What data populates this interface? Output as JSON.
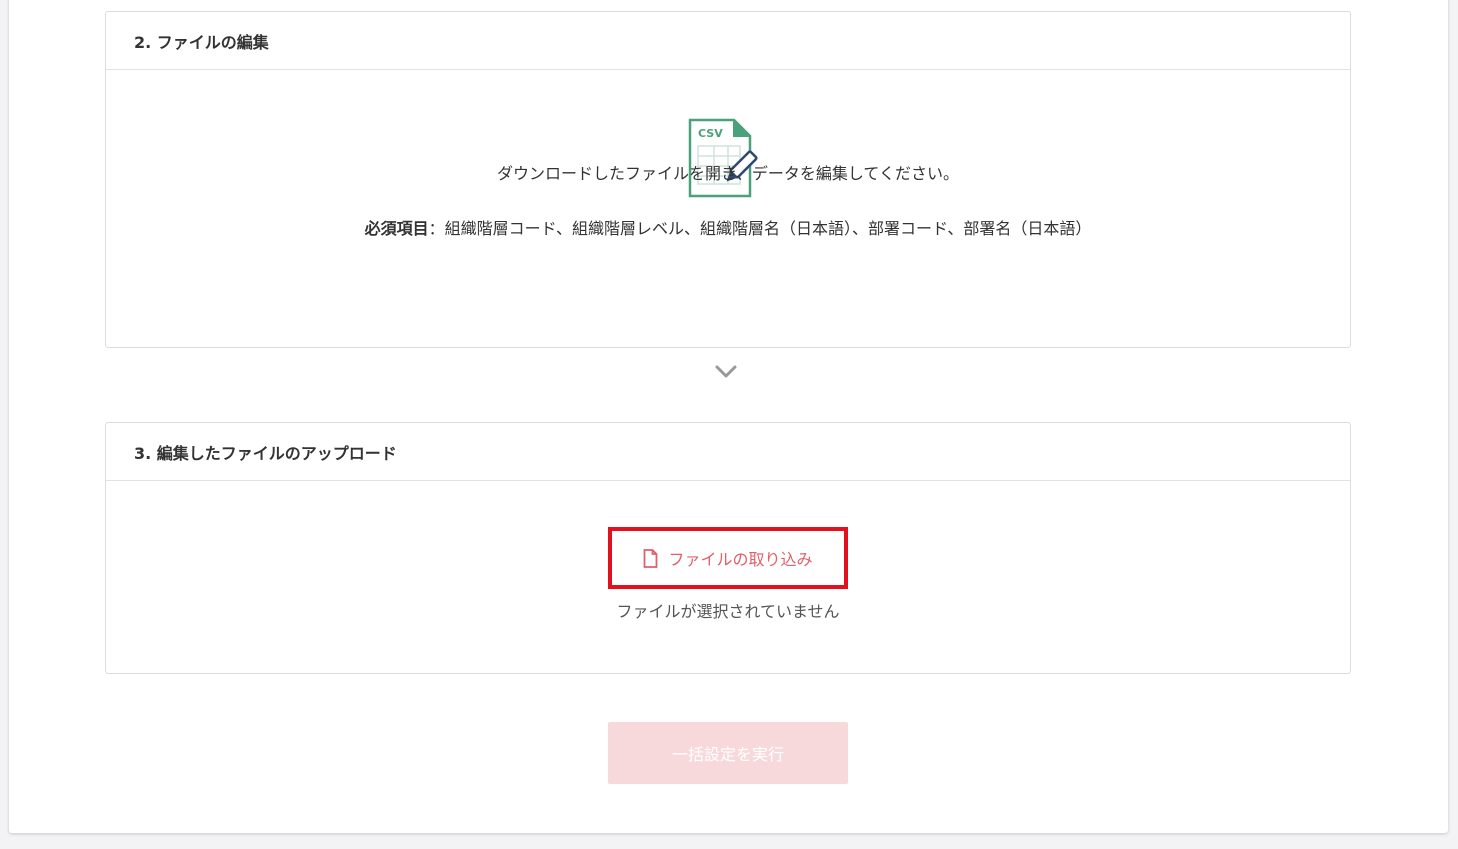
{
  "section2": {
    "title": "2. ファイルの編集",
    "icon": "csv-edit-icon",
    "icon_text": "CSV",
    "description": "ダウンロードしたファイルを開き、データを編集してください。",
    "required_label": "必須項目",
    "required_items": "：組織階層コード、組織階層レベル、組織階層名（日本語）、部署コード、部署名（日本語）"
  },
  "section3": {
    "title": "3. 編集したファイルのアップロード",
    "upload_label": "ファイルの取り込み",
    "no_file_text": "ファイルが選択されていません"
  },
  "execute": {
    "label": "一括設定を実行"
  },
  "colors": {
    "accent": "#e0606a",
    "highlight_border": "#e3101e",
    "disabled_button": "#f7d9dc",
    "csv_green": "#4aa27a",
    "pencil_blue": "#2f4a6e"
  }
}
